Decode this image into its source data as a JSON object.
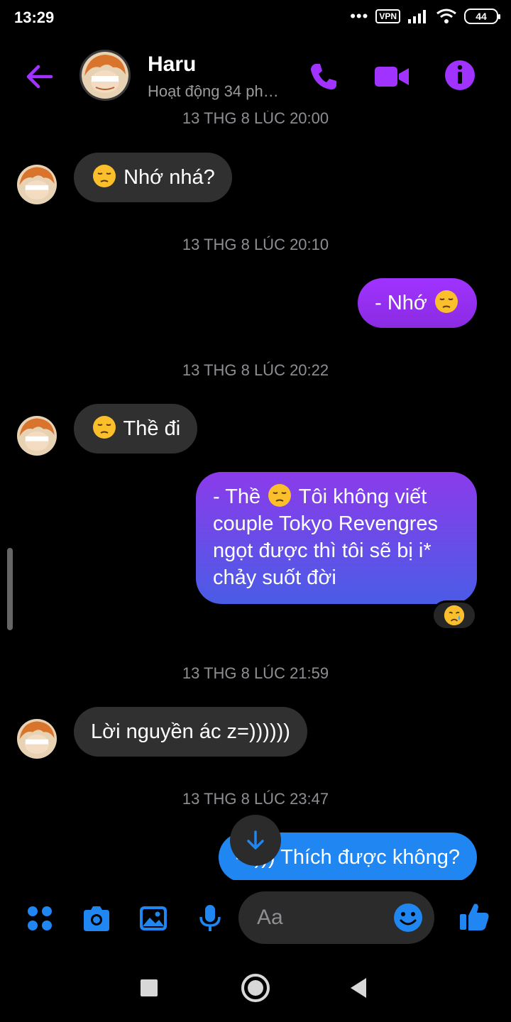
{
  "status_bar": {
    "time": "13:29",
    "dots": "•••",
    "vpn": "VPN",
    "battery": "44"
  },
  "header": {
    "name": "Haru",
    "status": "Hoạt động 34 ph…"
  },
  "conversation": [
    {
      "kind": "timestamp",
      "text": "13 THG 8 LÚC 20:00"
    },
    {
      "kind": "incoming",
      "emoji": "pensive-face",
      "text": "Nhớ nhá?"
    },
    {
      "kind": "timestamp",
      "text": "13 THG 8 LÚC 20:10"
    },
    {
      "kind": "outgoing",
      "text": "- Nhớ",
      "emoji_after": "pensive-face"
    },
    {
      "kind": "timestamp",
      "text": "13 THG 8 LÚC 20:22"
    },
    {
      "kind": "incoming",
      "emoji": "pensive-face",
      "text": "Thề đi"
    },
    {
      "kind": "outgoing",
      "text_before": "- Thề",
      "emoji": "pensive-face",
      "text_after": "Tôi không viết couple Tokyo Revengres ngọt được thì tôi sẽ bị i* chảy suốt đời",
      "reaction": "crying-face"
    },
    {
      "kind": "timestamp",
      "text": "13 THG 8 LÚC 21:59"
    },
    {
      "kind": "incoming",
      "text": "Lời nguyền ác z=))))))"
    },
    {
      "kind": "timestamp",
      "text": "13 THG 8 LÚC 23:47"
    },
    {
      "kind": "outgoing",
      "text": "-=))) Thích được không?"
    }
  ],
  "composer": {
    "placeholder": "Aa",
    "icons": [
      "apps-icon",
      "camera-icon",
      "image-icon",
      "microphone-icon",
      "emoji-icon",
      "thumbs-up-icon"
    ]
  },
  "colors": {
    "accent_purple": "#a033ff",
    "messenger_blue": "#1f86f2",
    "incoming_bubble": "#303030"
  }
}
